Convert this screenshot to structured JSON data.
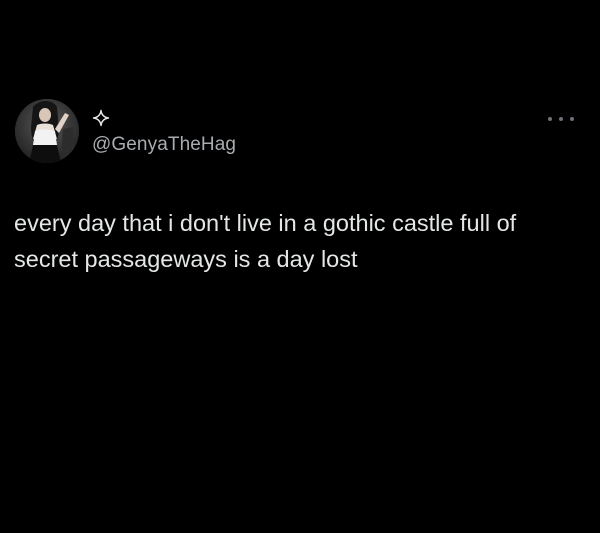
{
  "tweet": {
    "display_name_icon": "sparkle-icon",
    "handle": "@GenyaTheHag",
    "more_icon": "more-options-icon",
    "text": "every day that i don't live in a gothic castle full of\nsecret passageways is a day lost"
  },
  "colors": {
    "background": "#000000",
    "text": "#e4e6e7",
    "handle": "#a9acaf",
    "muted_icon": "#6e7175"
  }
}
